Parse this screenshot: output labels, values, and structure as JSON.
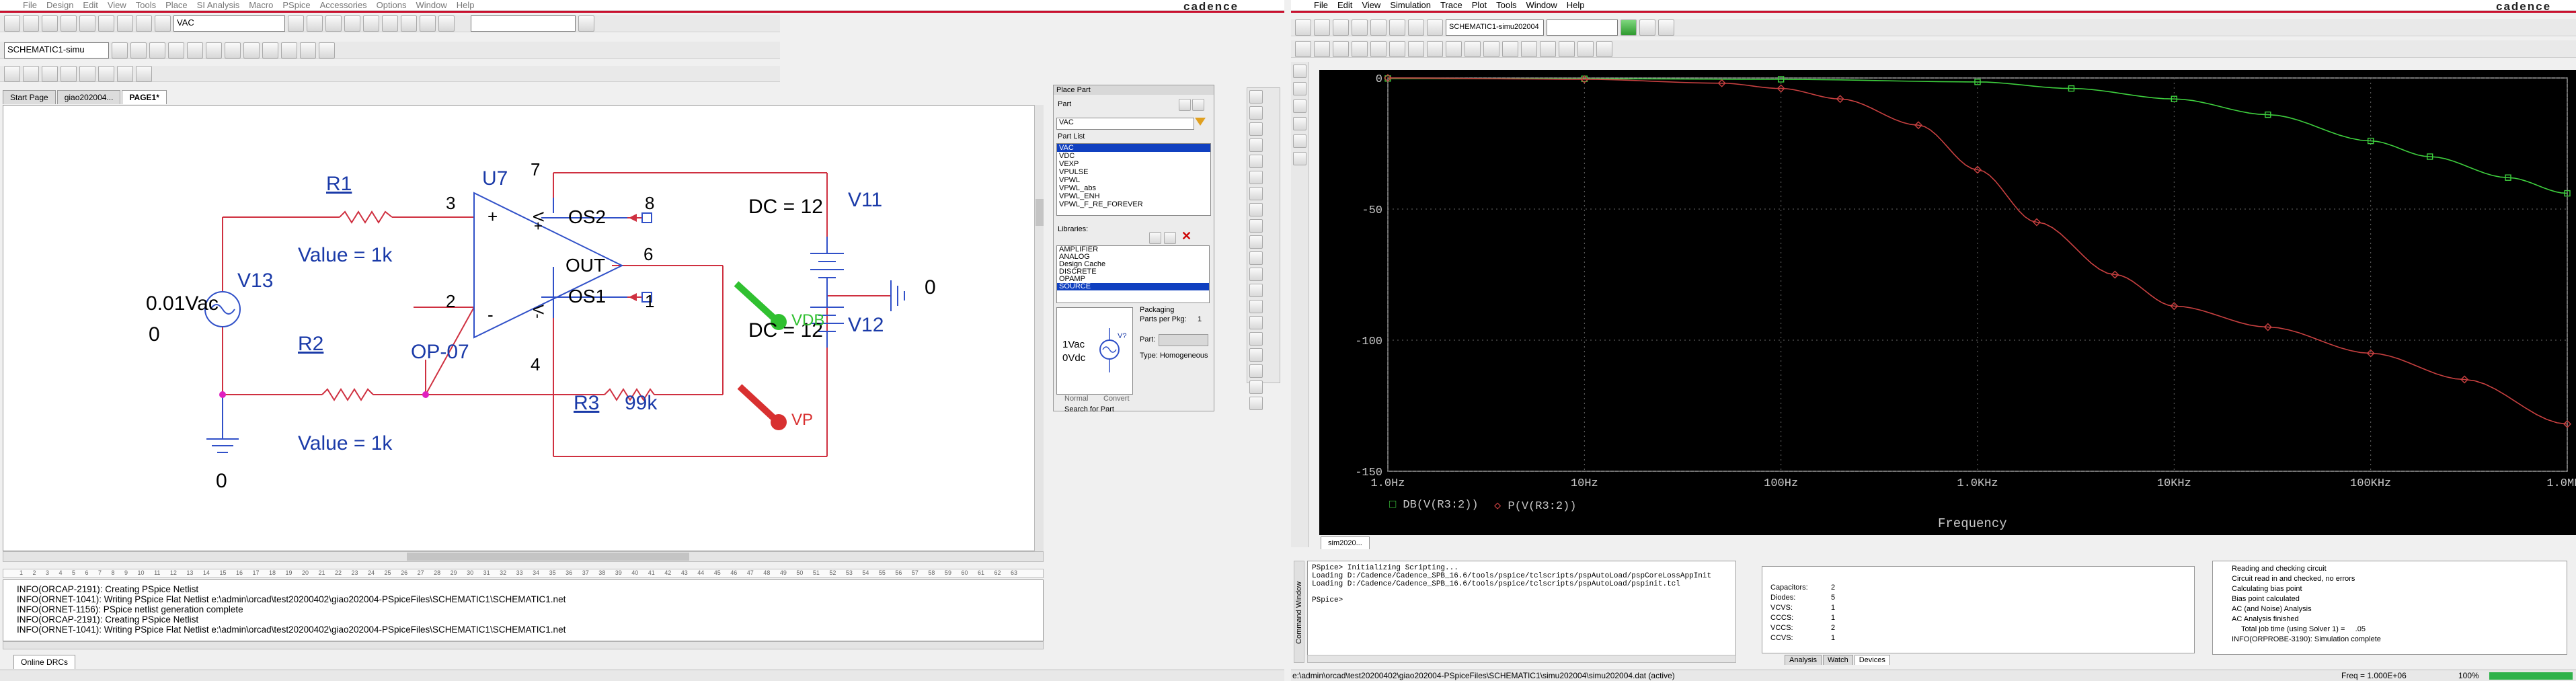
{
  "left_app": {
    "menu": [
      "File",
      "Design",
      "Edit",
      "View",
      "Tools",
      "Place",
      "SI Analysis",
      "Macro",
      "PSpice",
      "Accessories",
      "Options",
      "Window",
      "Help"
    ],
    "brand": "cadence",
    "part_combo": "VAC",
    "design_combo": "SCHEMATIC1-simu",
    "tabs": [
      "Start Page",
      "giao202004...",
      "PAGE1*"
    ],
    "schematic": {
      "r1": "R1",
      "r1_value": "Value = 1k",
      "r2": "R2",
      "r2_value": "Value = 1k",
      "r3": "R3",
      "r3_value": "99k",
      "u7": "U7",
      "opamp_model": "OP-07",
      "v13": "V13",
      "v13_ac": "0.01Vac",
      "v13_dc": "0",
      "v11": "V11",
      "v11_dc": "DC = 12",
      "v12": "V12",
      "v12_dc": "DC = 12",
      "gnd_left": "0",
      "gnd_right": "0",
      "pin3": "3",
      "pin2": "2",
      "pin7": "7",
      "pin4": "4",
      "pin6": "6",
      "pin8": "8",
      "pin1": "1",
      "plus": "+",
      "minus": "-",
      "vplus": "V+",
      "vminus": "V-",
      "os2": "OS2",
      "os1": "OS1",
      "out": "OUT",
      "vdb": "VDB",
      "vp": "VP"
    },
    "log_ruler": "1 2 3 4 5 6 7 8 9 10 11 12 13 14 15 16 17 18 19 20 21 22 23 24 25 26 27 28 29 30 31 32 33 34 35 36 37 38 39 40 41 42 43 44 45 46 47 48 49 50 51 52 53 54 55 56 57 58 59 60 61 62 63",
    "log_lines": [
      "INFO(ORCAP-2191): Creating PSpice Netlist",
      "INFO(ORNET-1041): Writing PSpice Flat Netlist e:\\admin\\orcad\\test20200402\\giao202004-PSpiceFiles\\SCHEMATIC1\\SCHEMATIC1.net",
      "INFO(ORNET-1156): PSpice netlist generation complete",
      "INFO(ORCAP-2191): Creating PSpice Netlist",
      "INFO(ORNET-1041): Writing PSpice Flat Netlist e:\\admin\\orcad\\test20200402\\giao202004-PSpiceFiles\\SCHEMATIC1\\SCHEMATIC1.net"
    ],
    "status_tab": "Online DRCs"
  },
  "place_part": {
    "title": "Place Part",
    "part_label": "Part",
    "part_value": "VAC",
    "part_list_label": "Part List",
    "parts": [
      "VAC",
      "VDC",
      "VEXP",
      "VPULSE",
      "VPWL",
      "VPWL_abs",
      "VPWL_ENH",
      "VPWL_F_RE_FOREVER"
    ],
    "selected_part": "VAC",
    "libraries_label": "Libraries:",
    "libraries": [
      "AMPLIFIER",
      "ANALOG",
      "Design Cache",
      "DISCRETE",
      "OPAMP",
      "SOURCE"
    ],
    "selected_library": "SOURCE",
    "packaging": "Packaging",
    "parts_per_pkg_label": "Parts per Pkg:",
    "parts_per_pkg": "1",
    "part_field": "Part:",
    "type_label": "Type: Homogeneous",
    "preview_ac": "1Vac",
    "preview_dc": "0Vdc",
    "preview_ref": "V?",
    "normal": "Normal",
    "convert": "Convert",
    "search": "Search for Part"
  },
  "right_app": {
    "menu": [
      "File",
      "Edit",
      "View",
      "Simulation",
      "Trace",
      "Plot",
      "Tools",
      "Window",
      "Help"
    ],
    "brand": "cadence",
    "profile_combo": "SCHEMATIC1-simu202004",
    "plot_tab": "sim2020...",
    "cmd_lines": [
      "PSpice> Initializing Scripting...",
      "Loading D:/Cadence/Cadence_SPB_16.6/tools/pspice/tclscripts/pspAutoLoad/pspCoreLossAppInit",
      "Loading D:/Cadence/Cadence_SPB_16.6/tools/pspice/tclscripts/pspAutoLoad/pspinit.tcl",
      "",
      "PSpice>"
    ],
    "cmd_side_label": "Command Window",
    "devices": [
      {
        "name": "Capacitors:",
        "count": "2"
      },
      {
        "name": "Diodes:",
        "count": "5"
      },
      {
        "name": "VCVS:",
        "count": "1"
      },
      {
        "name": "CCCS:",
        "count": "1"
      },
      {
        "name": "VCCS:",
        "count": "2"
      },
      {
        "name": "CCVS:",
        "count": "1"
      }
    ],
    "device_tabs": [
      "Analysis",
      "Watch",
      "Devices"
    ],
    "sim_status": [
      "Reading and checking circuit",
      "Circuit read in and checked, no errors",
      "Calculating bias point",
      "Bias point calculated",
      "AC (and Noise) Analysis",
      "AC Analysis finished",
      "Total job time (using Solver 1) =     .05",
      "INFO(ORPROBE-3190): Simulation complete"
    ],
    "status_path": "e:\\admin\\orcad\\test20200402\\giao202004-PSpiceFiles\\SCHEMATIC1\\simu202004\\simu202004.dat (active)",
    "status_freq": "Freq = 1.000E+06",
    "status_zoom": "100%"
  },
  "chart_data": {
    "type": "line",
    "x_scale": "log",
    "xlim": [
      1,
      1000000
    ],
    "ylim": [
      -150,
      0
    ],
    "grid": true,
    "xlabel": "Frequency",
    "x_ticks": [
      {
        "v": 1,
        "label": "1.0Hz"
      },
      {
        "v": 10,
        "label": "10Hz"
      },
      {
        "v": 100,
        "label": "100Hz"
      },
      {
        "v": 1000,
        "label": "1.0KHz"
      },
      {
        "v": 10000,
        "label": "10KHz"
      },
      {
        "v": 100000,
        "label": "100KHz"
      },
      {
        "v": 1000000,
        "label": "1.0MHz"
      }
    ],
    "y_ticks": [
      0,
      -50,
      -100,
      -150
    ],
    "series": [
      {
        "name": "DB(V(R3:2))",
        "color": "#3ecf3e",
        "marker": "square",
        "x": [
          1,
          10,
          100,
          1000,
          3000,
          10000,
          30000,
          100000,
          200000,
          500000,
          1000000
        ],
        "y": [
          -0.2,
          -0.3,
          -0.5,
          -1.5,
          -4,
          -8,
          -14,
          -24,
          -30,
          -38,
          -44
        ]
      },
      {
        "name": "P(V(R3:2))",
        "color": "#c84040",
        "marker": "diamond",
        "x": [
          1,
          10,
          50,
          100,
          200,
          500,
          1000,
          2000,
          5000,
          10000,
          30000,
          100000,
          300000,
          1000000
        ],
        "y": [
          0,
          -0.5,
          -2,
          -4,
          -8,
          -18,
          -35,
          -55,
          -75,
          -87,
          -95,
          -105,
          -115,
          -132
        ]
      }
    ]
  }
}
